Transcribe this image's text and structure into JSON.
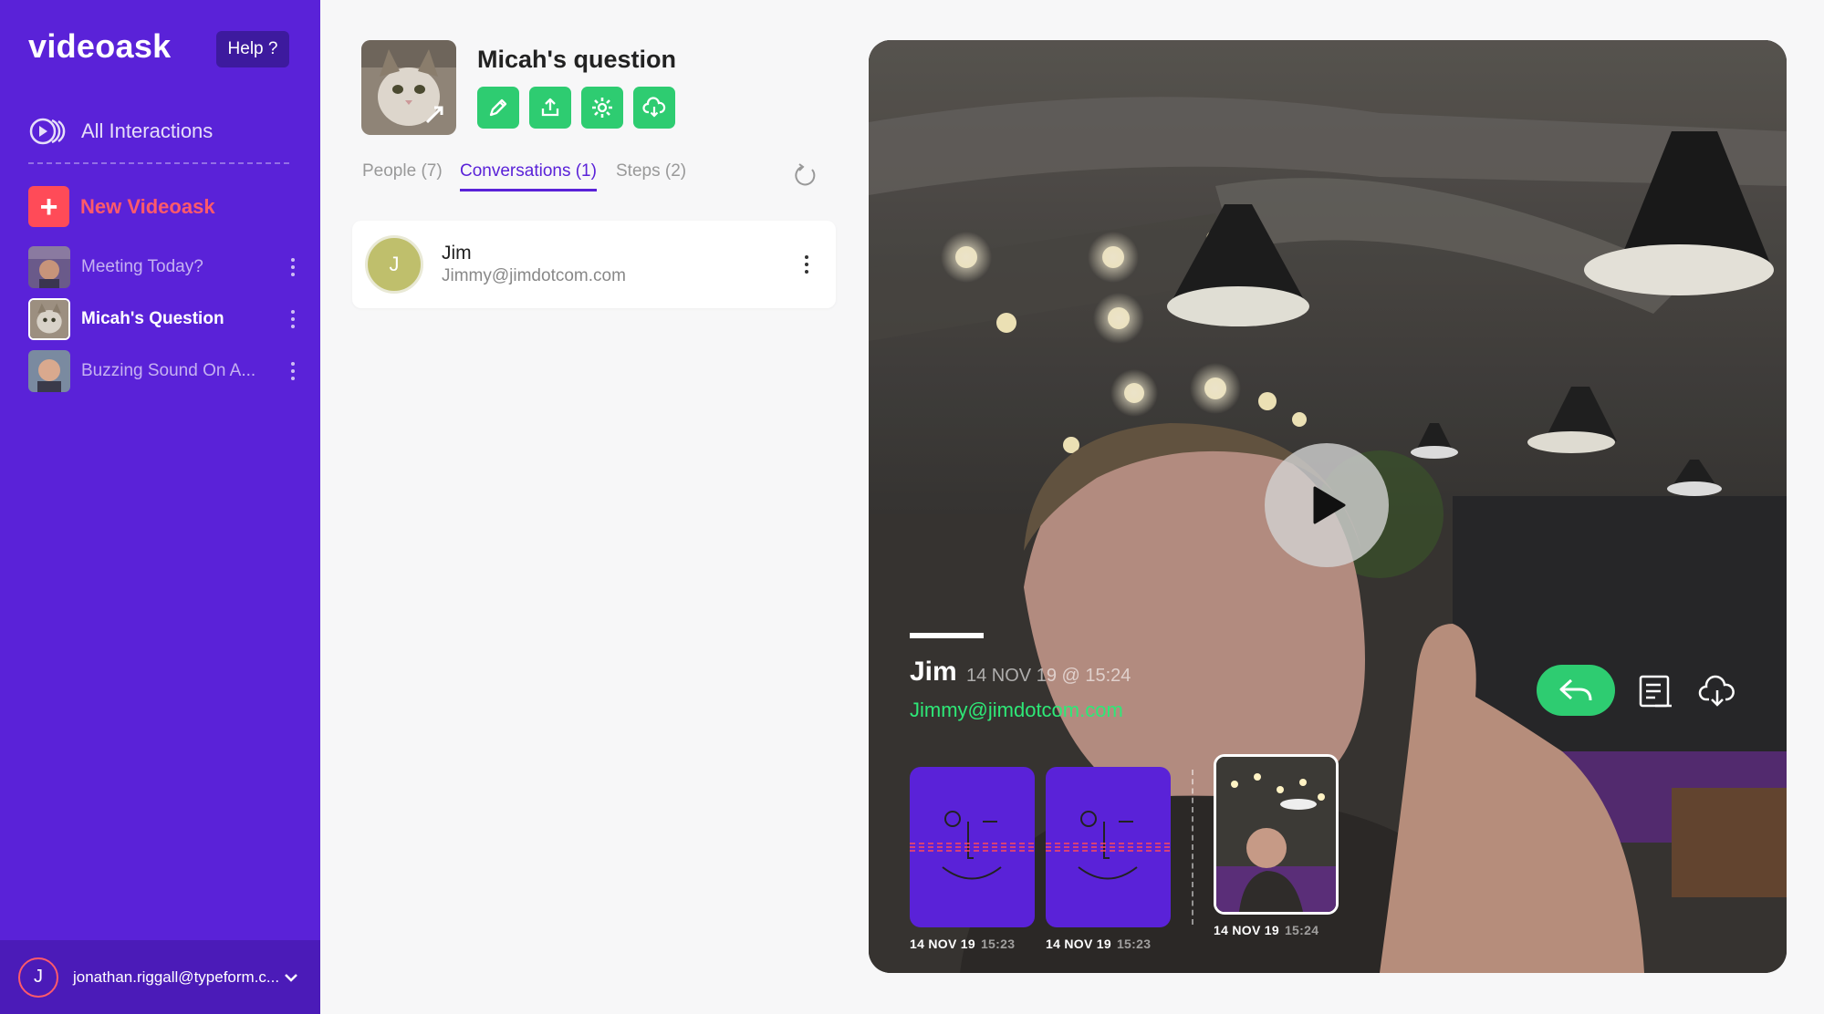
{
  "sidebar": {
    "logo": "videoask",
    "help_label": "Help ?",
    "all_interactions_label": "All Interactions",
    "new_videoask_label": "New Videoask",
    "items": [
      {
        "label": "Meeting Today?",
        "active": false
      },
      {
        "label": "Micah's Question",
        "active": true
      },
      {
        "label": "Buzzing Sound On A...",
        "active": false
      }
    ],
    "account": {
      "initial": "J",
      "email": "jonathan.riggall@typeform.c..."
    }
  },
  "question": {
    "title": "Micah's question",
    "actions": [
      "edit-icon",
      "share-icon",
      "settings-icon",
      "download-icon"
    ]
  },
  "tabs": [
    {
      "label": "People (7)",
      "active": false
    },
    {
      "label": "Conversations (1)",
      "active": true
    },
    {
      "label": "Steps (2)",
      "active": false
    }
  ],
  "conversation": {
    "initial": "J",
    "name": "Jim",
    "email": "Jimmy@jimdotcom.com"
  },
  "video": {
    "name": "Jim",
    "date": "14 NOV 19 @ 15:24",
    "email": "Jimmy@jimdotcom.com",
    "clips": [
      {
        "date": "14 NOV 19",
        "time": "15:23"
      },
      {
        "date": "14 NOV 19",
        "time": "15:23"
      },
      {
        "date": "14 NOV 19",
        "time": "15:24"
      }
    ]
  },
  "colors": {
    "sidebar": "#5a22d8",
    "accent_green": "#2ecc71",
    "accent_red": "#ff4b58"
  }
}
